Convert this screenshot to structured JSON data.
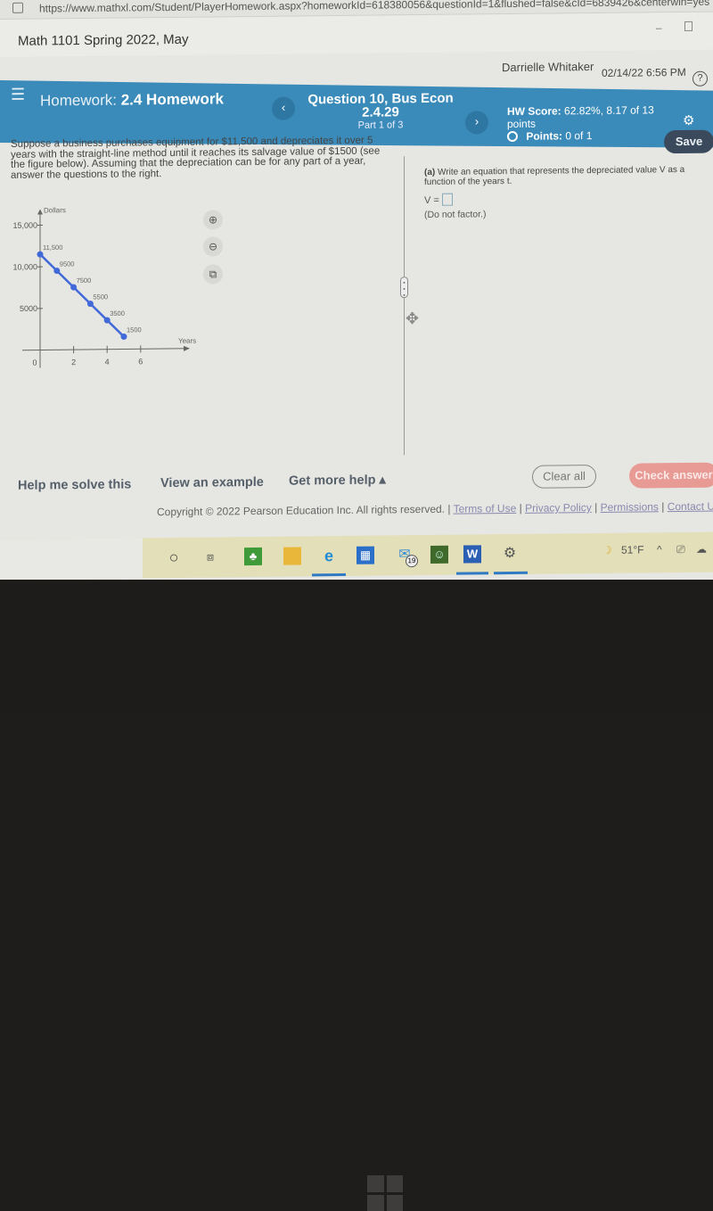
{
  "browser": {
    "url": "https://www.mathxl.com/Student/PlayerHomework.aspx?homeworkId=618380056&questionId=1&flushed=false&cId=6839426&centerwin=yes"
  },
  "course": {
    "title": "Math 1101 Spring 2022, May"
  },
  "user": {
    "name": "Darrielle Whitaker",
    "datetime": "02/14/22 6:56 PM",
    "help_icon": "?"
  },
  "header": {
    "menu_icon": "☰",
    "homework_label": "Homework:",
    "homework_name": "2.4 Homework",
    "prev_icon": "‹",
    "next_icon": "›",
    "question_title": "Question 10, Bus Econ",
    "question_code": "2.4.29",
    "part": "Part 1 of 3",
    "hw_score_label": "HW Score:",
    "hw_score_value": "62.82%, 8.17 of 13",
    "hw_score_unit": "points",
    "points_label": "Points:",
    "points_value": "0 of 1",
    "settings_icon": "⚙",
    "save_label": "Save"
  },
  "problem": {
    "text": "Suppose a business purchases equipment for $11,500 and depreciates it over 5 years with the straight-line method until it reaches its salvage value of $1500 (see the figure below). Assuming that the depreciation can be for any part of a year, answer the questions to the right."
  },
  "question": {
    "part_a_label": "(a)",
    "part_a_text": "Write an equation that represents the depreciated value V as a function of the years t.",
    "answer_prefix": "V =",
    "answer_value": "",
    "hint": "(Do not factor.)"
  },
  "graph_tools": {
    "zoom_in": "⊕",
    "zoom_out": "⊖",
    "popout": "⧉"
  },
  "chart_data": {
    "type": "line",
    "title": "",
    "xlabel": "Years",
    "ylabel": "Dollars",
    "x": [
      0,
      1,
      2,
      3,
      4,
      5
    ],
    "values": [
      11500,
      9500,
      7500,
      5500,
      3500,
      1500
    ],
    "data_labels": [
      "11,500",
      "9500",
      "7500",
      "5500",
      "3500",
      "1500"
    ],
    "x_ticks": [
      "0",
      "2",
      "4",
      "6"
    ],
    "y_ticks": [
      "5000",
      "10,000",
      "15,000"
    ],
    "xlim": [
      0,
      7
    ],
    "ylim": [
      0,
      15000
    ],
    "color": "#4169d8"
  },
  "actions": {
    "help_me_solve": "Help me solve this",
    "view_example": "View an example",
    "get_more_help": "Get more help ▴",
    "clear_all": "Clear all",
    "check_answer": "Check answer"
  },
  "footer": {
    "copyright": "Copyright © 2022 Pearson Education Inc. All rights reserved. |",
    "links": [
      "Terms of Use",
      "Privacy Policy",
      "Permissions",
      "Contact Us"
    ]
  },
  "taskbar": {
    "mail_badge": "19",
    "weather": "51°F",
    "tray_chevron": "^"
  },
  "colors": {
    "accent": "#3b8bba",
    "check_answer": "#e89a95",
    "save": "#3a4a5c"
  }
}
